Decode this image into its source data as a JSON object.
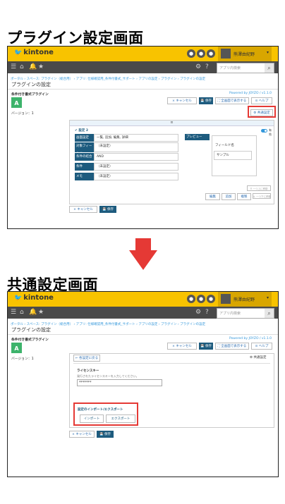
{
  "headings": {
    "top": "プラグイン設定画面",
    "bottom": "共通設定画面"
  },
  "app": {
    "brand": "kintone",
    "user_name": "熊澤由紀野",
    "search_placeholder": "アプリ内検索",
    "breadcrumb": "ポータル › スペース: プラグイン（総合用） › アプリ: 仕様確認用_条件付書式_サポート › アプリの設定 › プラグイン › プラグインの設定",
    "page_title": "プラグインの設定",
    "plugin_name": "条件付き書式プラグイン",
    "plugin_icon_letter": "A",
    "version": "バージョン：1",
    "powered_by": "Powered by JOYZO / v1.1.0",
    "colors": {
      "topbar": "#f8c300",
      "navbar": "#4a4a4a",
      "primary": "#1d5b7e",
      "highlight": "#e53935",
      "plugin_icon": "#3db36b"
    }
  },
  "buttons": {
    "cancel": "× キャンセル",
    "save": "💾 保存",
    "fullscreen": "⛶ 全画面で表示する",
    "help": "⊙ ヘルプ",
    "common_settings": "⚙ 共通設定",
    "back_to_settings": "← 各設定に戻る",
    "edit": "編集",
    "add": "追加",
    "copy": "複製",
    "up": "⇈ 一つ上に移動",
    "down": "⇊ 一つ下に移動",
    "import": "インポート",
    "export": "エクスポート"
  },
  "setting": {
    "title": "✔ 設定 2",
    "enabled_label": "有効",
    "rows": [
      {
        "label": "画面設定",
        "value": "一覧, 追加, 編集, 詳細"
      },
      {
        "label": "対象フィールド",
        "value": "（未設定）"
      },
      {
        "label": "条件の結合",
        "value": "AND"
      },
      {
        "label": "条件",
        "value": "（未設定）"
      },
      {
        "label": "メモ",
        "value": "（未設定）"
      }
    ],
    "preview_label": "プレビュー",
    "preview_field": "フィールド名",
    "preview_sample": "サンプル"
  },
  "common": {
    "license_label": "ライセンスキー",
    "license_hint": "発行されたライセンスキーを入力してください。",
    "license_value": "*******",
    "import_export_label": "設定のインポート/エクスポート"
  }
}
